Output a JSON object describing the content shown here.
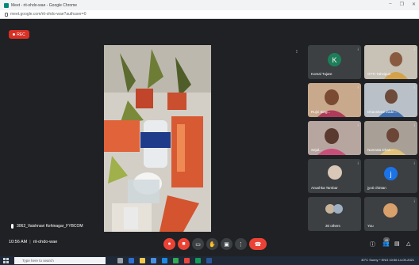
{
  "browser": {
    "title": "Meet - rit-ohdo-wae - Google Chrome",
    "url": "meet.google.com/rit-ohdo-wae?authuser=0",
    "window_controls": [
      "–",
      "❐",
      "✕"
    ]
  },
  "meet": {
    "rec_label": "REC",
    "presenter_label": "3062_Vaishnavi Kehinagar_FYBCOM",
    "meeting_time": "10:56 AM",
    "meeting_code": "rit-ohdo-wae",
    "participants": [
      {
        "name": "Komal Tujare",
        "avatar_letter": "K",
        "avatar_color": "#1e7e5a"
      },
      {
        "name": "GTTI Tahvipuri",
        "avatar_letter": "",
        "avatar_color": ""
      },
      {
        "name": "Rujni Sing...",
        "avatar_letter": "",
        "avatar_color": ""
      },
      {
        "name": "Dhanshree Zade...",
        "avatar_letter": "",
        "avatar_color": ""
      },
      {
        "name": "Sejal...",
        "avatar_letter": "",
        "avatar_color": ""
      },
      {
        "name": "Namrata Dhan...",
        "avatar_letter": "",
        "avatar_color": ""
      },
      {
        "name": "Anushka Tambar",
        "avatar_letter": "",
        "avatar_color": ""
      },
      {
        "name": "jyoti chintan",
        "avatar_letter": "j",
        "avatar_color": "#1a73e8"
      },
      {
        "name": "30 others",
        "avatar_letter": "",
        "avatar_color": ""
      },
      {
        "name": "You",
        "avatar_letter": "",
        "avatar_color": ""
      }
    ],
    "participant_count_badge": "45",
    "end_call_color": "#ea4335",
    "mic_off_color": "#ea4335"
  },
  "taskbar": {
    "search_placeholder": "Type here to search",
    "tray_text": "30°C  Sunny  ^  ENG  10:56  14-09-2021"
  }
}
